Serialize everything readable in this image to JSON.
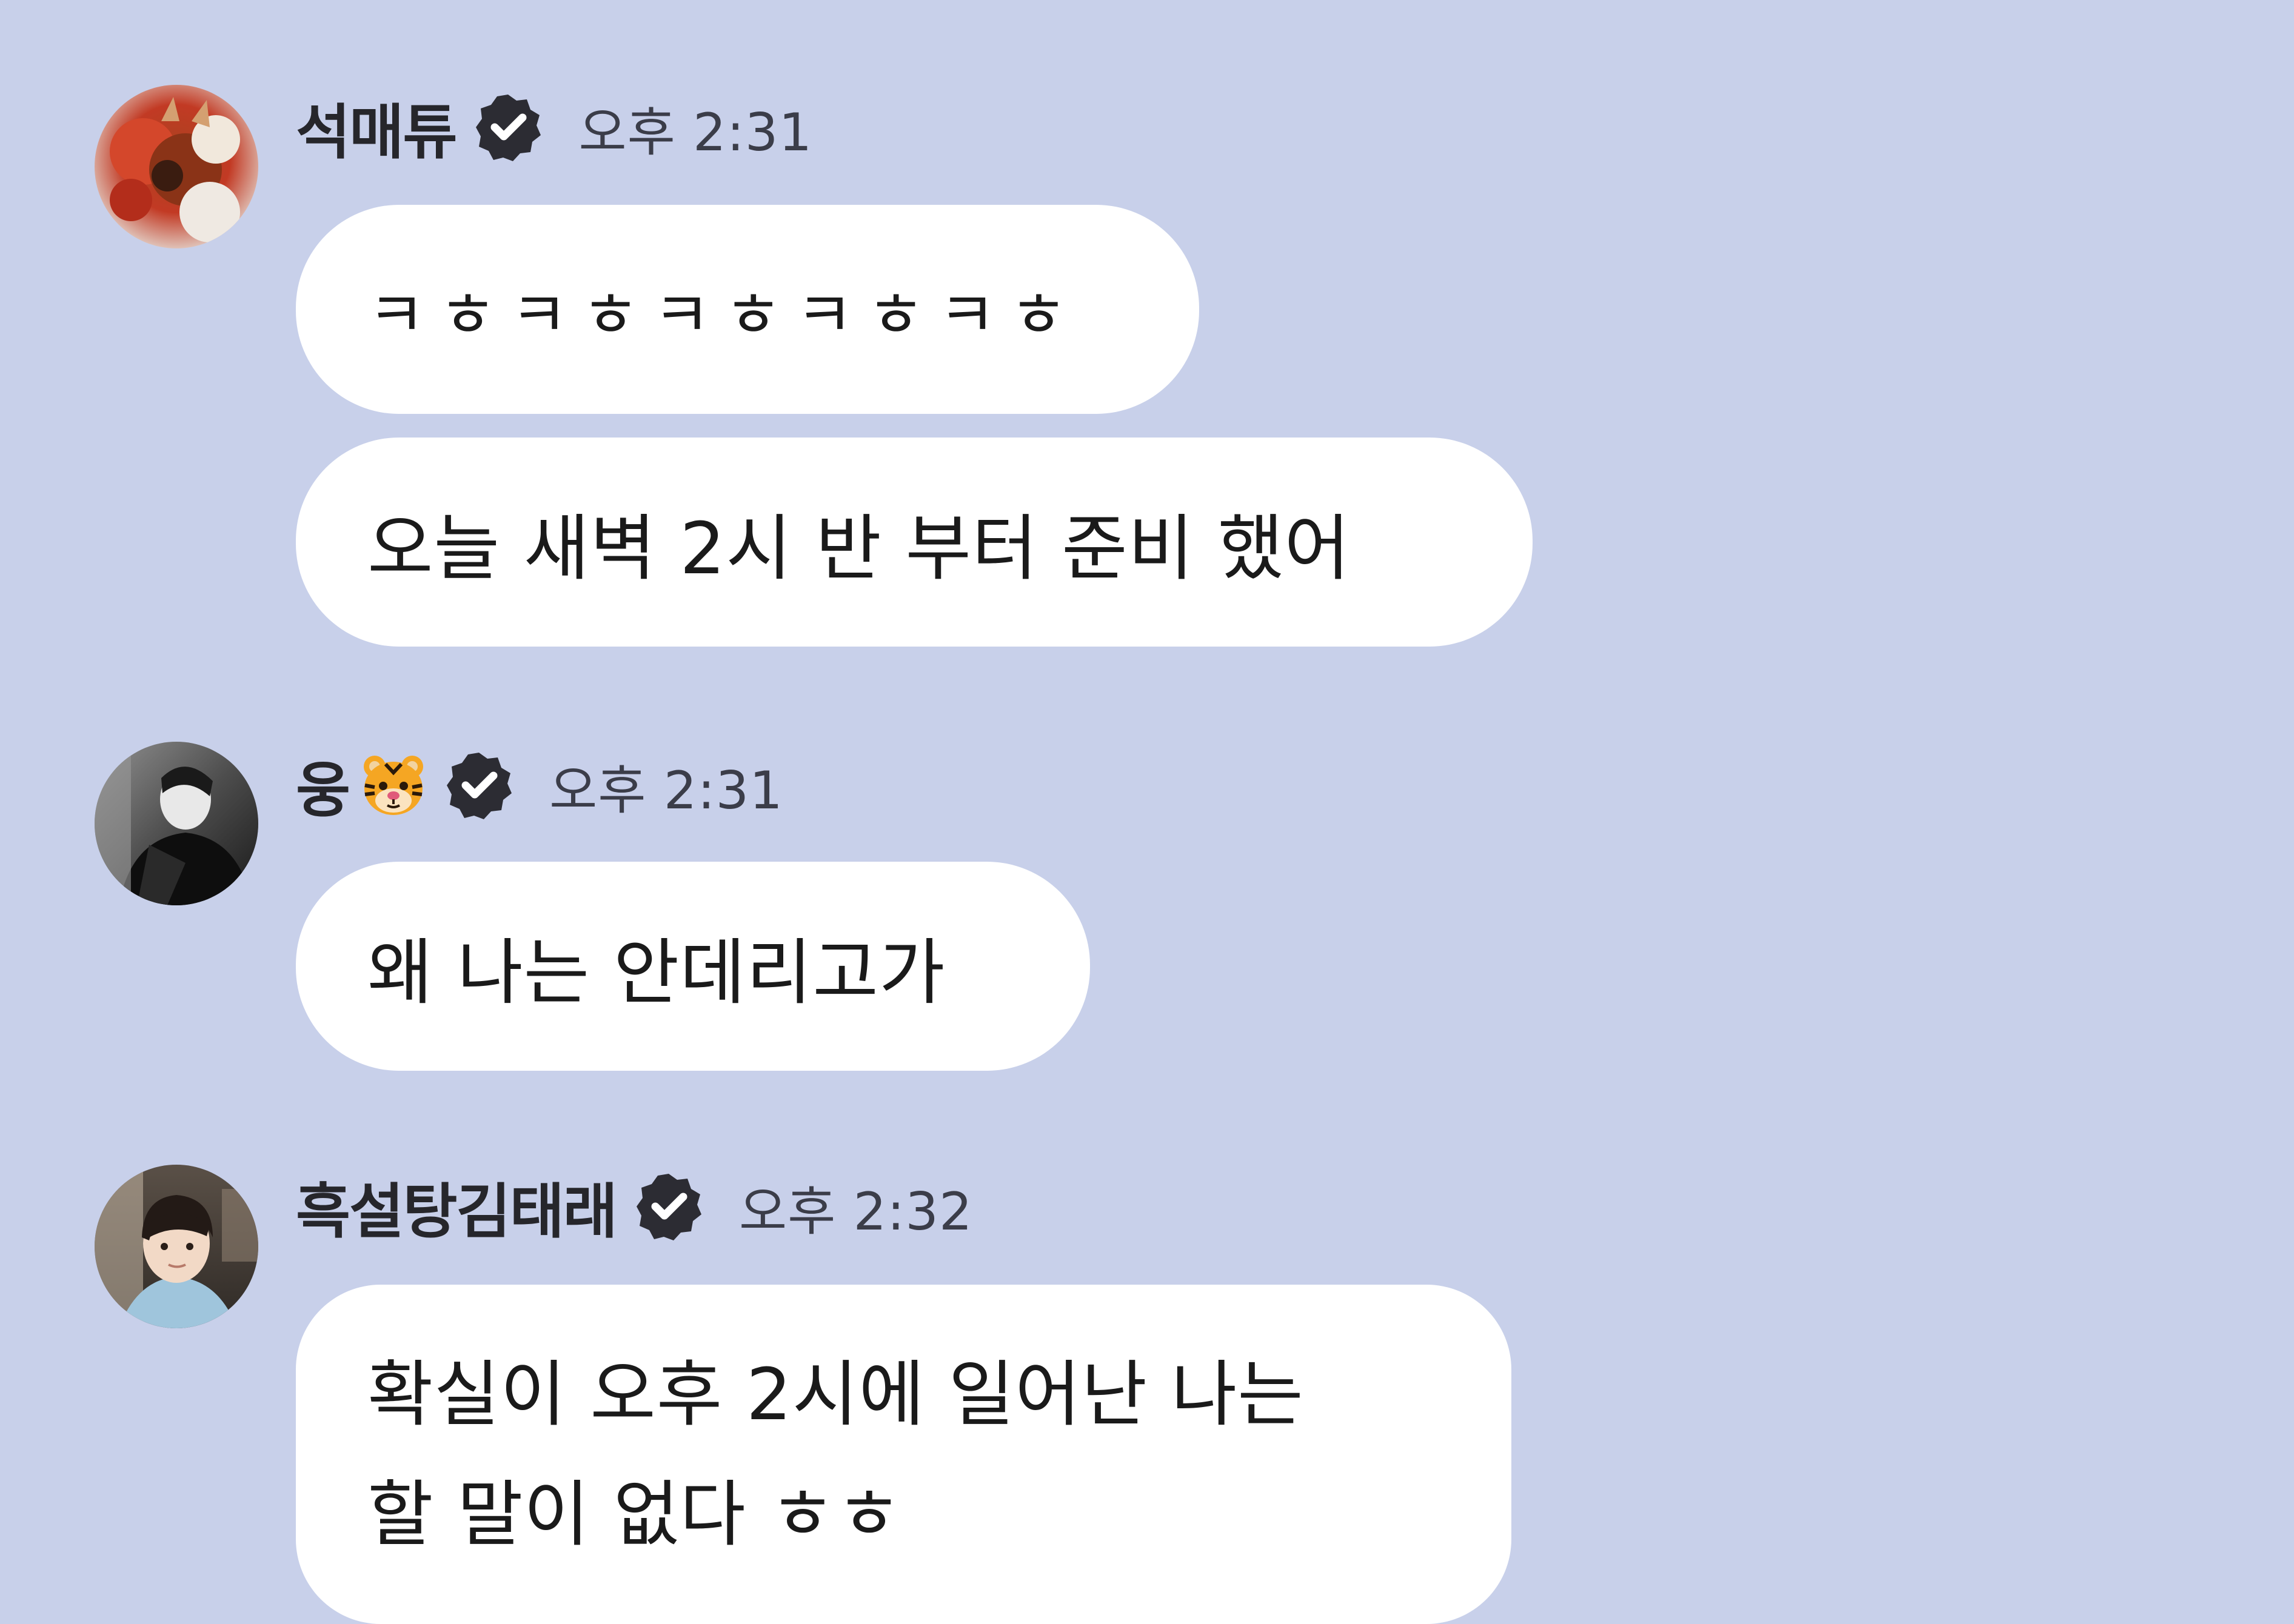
{
  "messages": [
    {
      "sender": "석매튜",
      "emoji": "",
      "time": "오후 2:31",
      "bubbles": [
        "ㅋㅎㅋㅎㅋㅎㅋㅎㅋㅎ",
        "오늘 새벽 2시 반 부터 준비 했어"
      ]
    },
    {
      "sender": "웅",
      "emoji": "tiger-face-emoji",
      "time": "오후 2:31",
      "bubbles": [
        "왜 나는 안데리고가"
      ]
    },
    {
      "sender": "흑설탕김태래",
      "emoji": "",
      "time": "오후 2:32",
      "bubbles": [
        {
          "lines": [
            "확실이 오후 2시에 일어난 나는",
            "할 말이 없다 ㅎㅎ"
          ]
        }
      ]
    }
  ],
  "colors": {
    "background": "#c8d0ea",
    "bubble": "#ffffff",
    "verified_badge": "#2c2c33",
    "text": "#1a1a1a"
  },
  "icons": {
    "verified": "verified-check-icon",
    "avatar_1": "avatar-red-floral-photo",
    "avatar_2": "avatar-monochrome-person-photo",
    "avatar_3": "avatar-person-selfie-photo"
  }
}
